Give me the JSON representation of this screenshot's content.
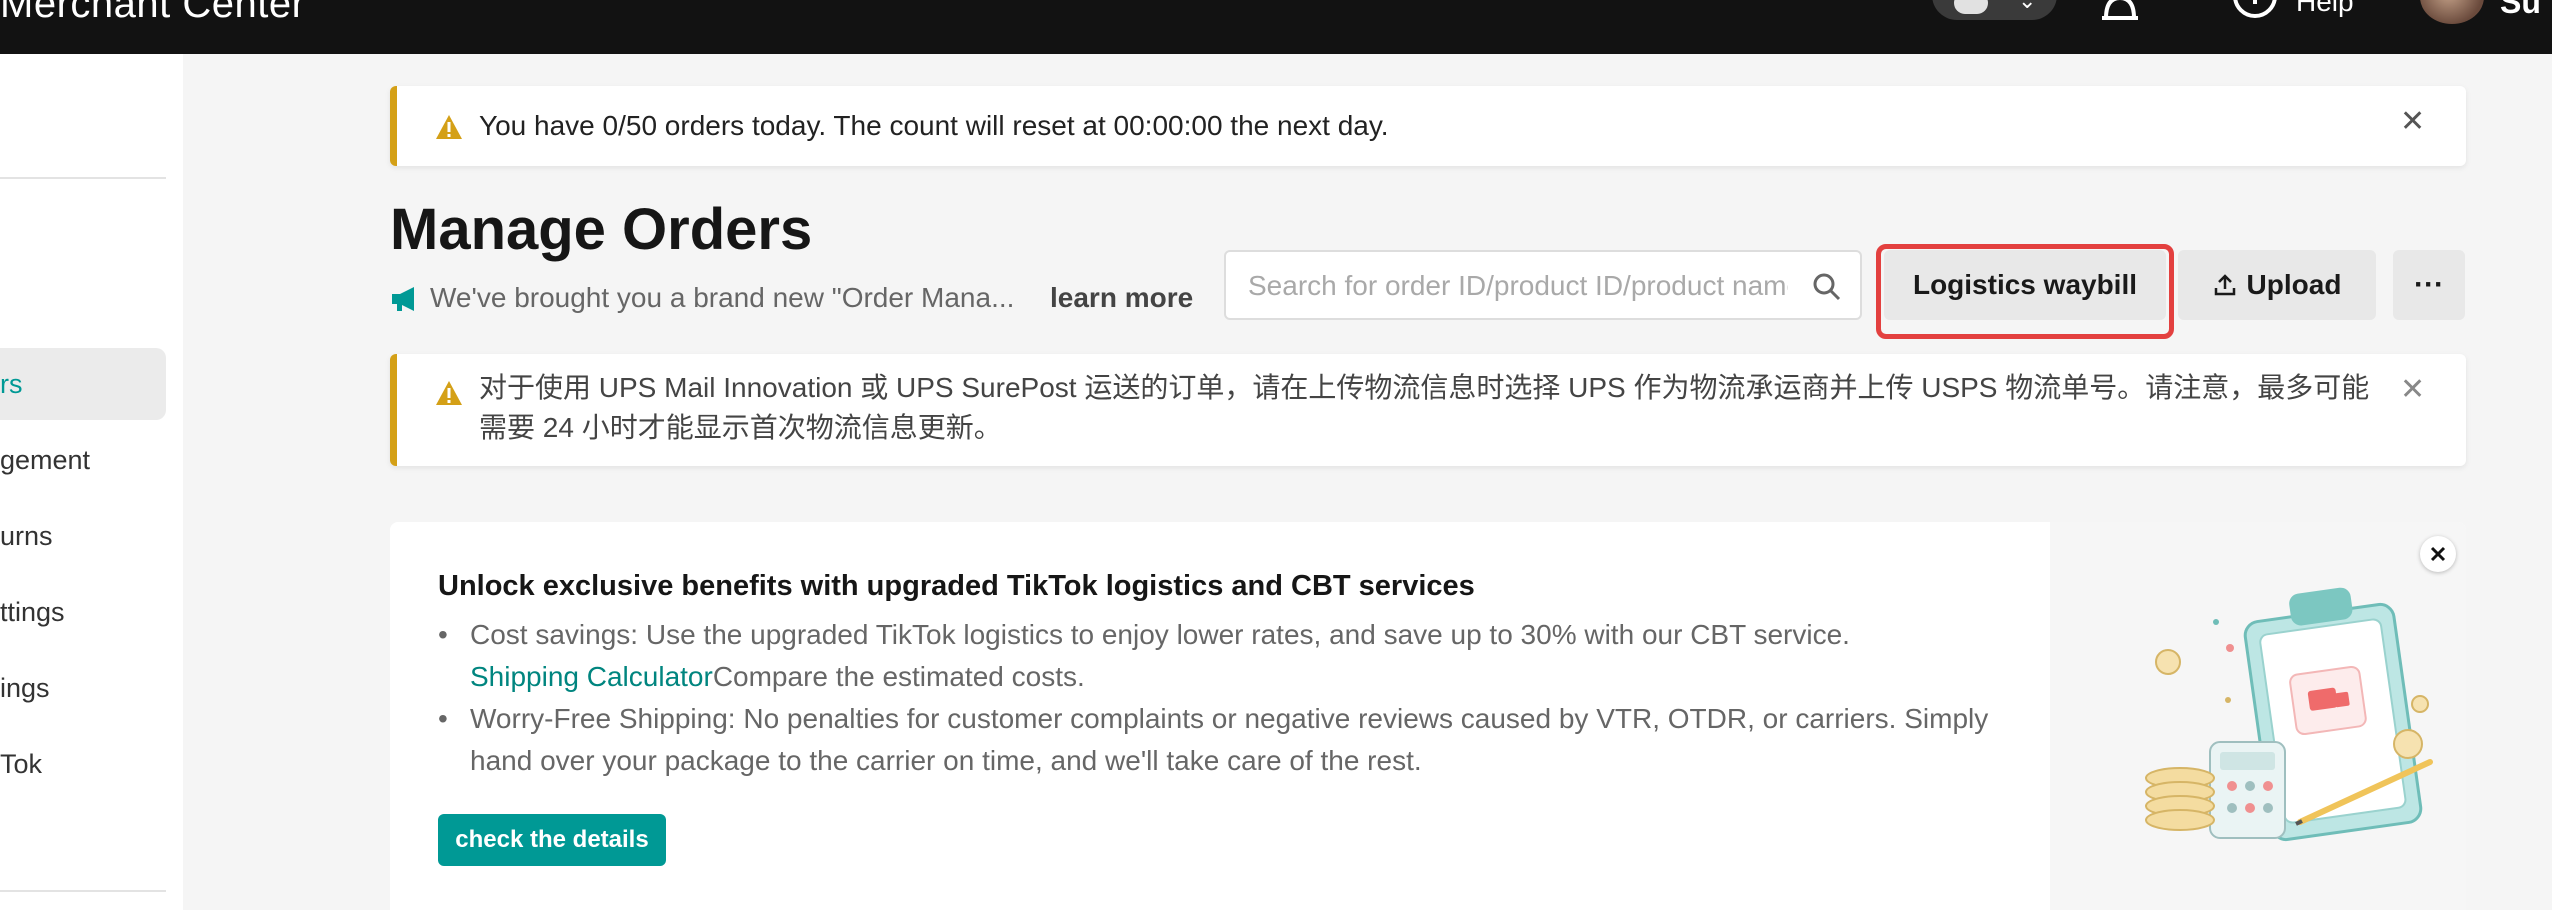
{
  "topbar": {
    "brand": "Merchant Center",
    "help_label": "Help",
    "username": "Su"
  },
  "sidebar": {
    "items": [
      {
        "label": "Orders",
        "visible": "rs",
        "active": true
      },
      {
        "label": "Management",
        "visible": "gement"
      },
      {
        "label": "Returns",
        "visible": "urns"
      },
      {
        "label": "Settings",
        "visible": "ttings"
      },
      {
        "label": "Settings",
        "visible": "ings"
      },
      {
        "label": "TikTok",
        "visible": "Tok"
      }
    ]
  },
  "order_limit_banner": {
    "message": "You have 0/50 orders today. The count will reset at 00:00:00 the next day."
  },
  "page": {
    "title": "Manage Orders",
    "announcement": "We've brought you a brand new \"Order Mana...",
    "learn_more": "learn more"
  },
  "search": {
    "placeholder": "Search for order ID/product ID/product name"
  },
  "actions": {
    "logistics_waybill": "Logistics waybill",
    "upload": "Upload",
    "more": "···"
  },
  "ups_banner": {
    "line1": "对于使用 UPS Mail Innovation 或 UPS SurePost 运送的订单，请在上传物流信息时选择 UPS 作为物流承运商并上传 USPS 物流单号。请注意，最多可能",
    "line2": "需要 24 小时才能显示首次物流信息更新。"
  },
  "promo": {
    "title": "Unlock exclusive benefits with upgraded TikTok logistics and CBT services",
    "bullet1_text": "Cost savings: Use the upgraded TikTok logistics to enjoy lower rates, and save up to 30% with our CBT service.",
    "bullet1_link": "Shipping Calculator",
    "bullet1_after": "Compare the estimated costs.",
    "bullet2_text": "Worry-Free Shipping: No penalties for customer complaints or negative reviews caused by VTR, OTDR, or carriers. Simply hand over your package to the carrier on time, and we'll take care of the rest.",
    "cta": "check the details",
    "bullet_char": "•"
  },
  "colors": {
    "accent": "#009995",
    "warning": "#d4a017",
    "highlight": "#e3403f"
  }
}
